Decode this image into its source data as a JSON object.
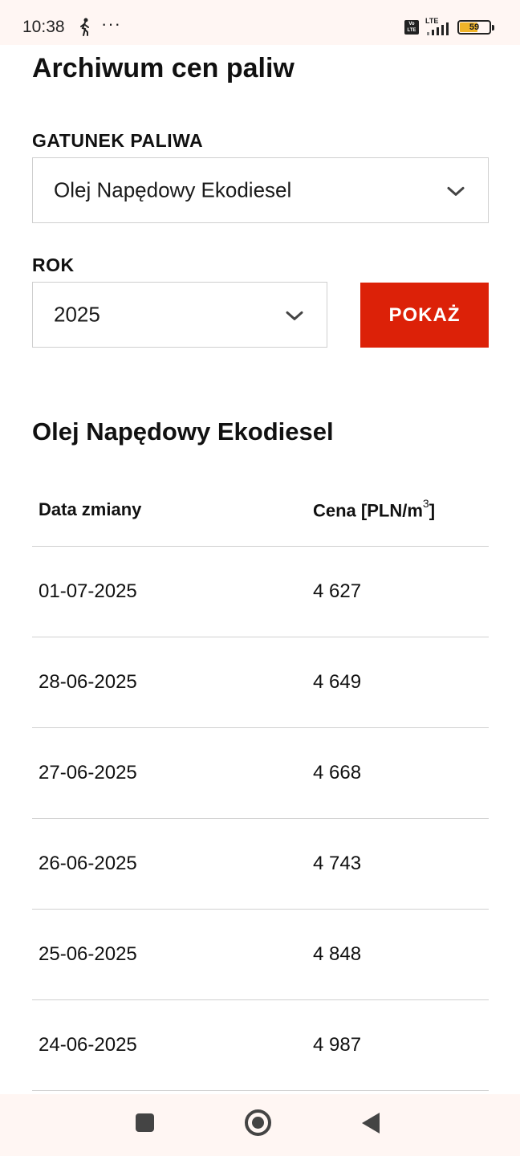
{
  "status_bar": {
    "time": "10:38",
    "more": "···",
    "volte": "Vo LTE",
    "network": "LTE",
    "battery": "59"
  },
  "page": {
    "title": "Archiwum cen paliw"
  },
  "form": {
    "fuel_label": "GATUNEK PALIWA",
    "fuel_value": "Olej Napędowy Ekodiesel",
    "year_label": "ROK",
    "year_value": "2025",
    "show_button": "POKAŻ"
  },
  "results": {
    "title": "Olej Napędowy Ekodiesel",
    "columns": {
      "date": "Data zmiany",
      "price": "Cena [PLN/m",
      "price_sup": "3",
      "price_close": "]"
    },
    "rows": [
      {
        "date": "01-07-2025",
        "price": "4 627"
      },
      {
        "date": "28-06-2025",
        "price": "4 649"
      },
      {
        "date": "27-06-2025",
        "price": "4 668"
      },
      {
        "date": "26-06-2025",
        "price": "4 743"
      },
      {
        "date": "25-06-2025",
        "price": "4 848"
      },
      {
        "date": "24-06-2025",
        "price": "4 987"
      }
    ]
  },
  "colors": {
    "accent": "#dc2108",
    "system_bar": "#fff6f3",
    "battery": "#f0b429"
  },
  "icons": [
    "walk-icon",
    "volte-icon",
    "signal-icon",
    "battery-icon",
    "chevron-down-icon",
    "recents-icon",
    "home-icon",
    "back-icon"
  ]
}
